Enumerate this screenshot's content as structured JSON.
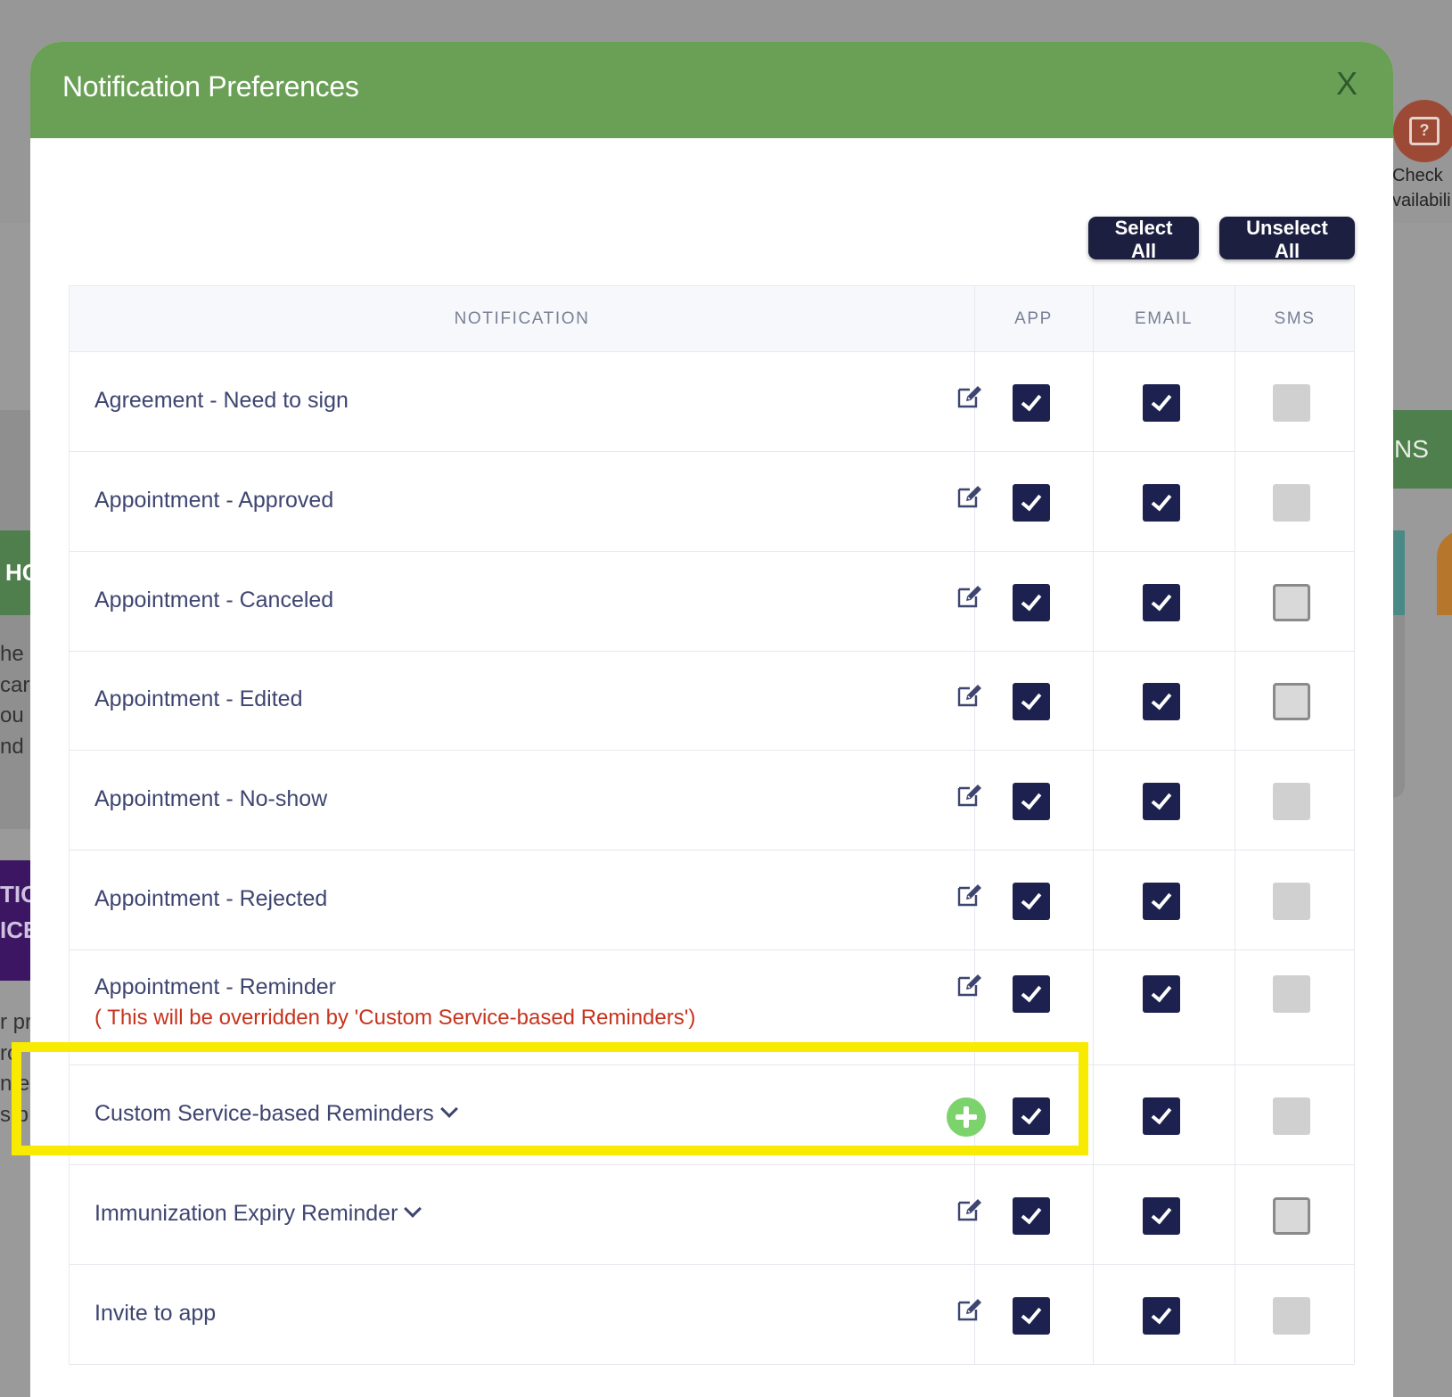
{
  "background": {
    "left_green_text": "HC",
    "left_text_lines": [
      "he",
      "car",
      "ou",
      "nd"
    ],
    "left_purple_lines": [
      "TIO",
      "ICE"
    ],
    "left_text_lines_2": [
      "r pr",
      "ro",
      "n e",
      "s p"
    ],
    "right_green_text": "NS",
    "calendar_label_1": "Check",
    "calendar_label_2": "vailabili",
    "calendar_icon": "calendar-question-icon"
  },
  "modal": {
    "title": "Notification Preferences",
    "close_label": "X",
    "select_all_label": "Select All",
    "unselect_all_label": "Unselect All"
  },
  "table": {
    "headers": {
      "notification": "NOTIFICATION",
      "app": "APP",
      "email": "EMAIL",
      "sms": "SMS"
    },
    "rows": [
      {
        "label": "Agreement - Need to sign",
        "action": "edit",
        "app": true,
        "email": true,
        "sms": "disabled"
      },
      {
        "label": "Appointment - Approved",
        "action": "edit",
        "app": true,
        "email": true,
        "sms": "disabled"
      },
      {
        "label": "Appointment - Canceled",
        "action": "edit",
        "app": true,
        "email": true,
        "sms": "unchecked"
      },
      {
        "label": "Appointment - Edited",
        "action": "edit",
        "app": true,
        "email": true,
        "sms": "unchecked"
      },
      {
        "label": "Appointment - No-show",
        "action": "edit",
        "app": true,
        "email": true,
        "sms": "disabled"
      },
      {
        "label": "Appointment - Rejected",
        "action": "edit",
        "app": true,
        "email": true,
        "sms": "disabled"
      },
      {
        "label": "Appointment - Reminder",
        "note": "( This will be overridden by 'Custom Service-based Reminders')",
        "action": "edit",
        "app": true,
        "email": true,
        "sms": "disabled"
      },
      {
        "label": "Custom Service-based Reminders",
        "expandable": true,
        "action": "add",
        "app": true,
        "email": true,
        "sms": "disabled",
        "highlighted": true
      },
      {
        "label": "Immunization Expiry Reminder",
        "expandable": true,
        "action": "edit",
        "app": true,
        "email": true,
        "sms": "unchecked"
      },
      {
        "label": "Invite to app",
        "action": "edit",
        "app": true,
        "email": true,
        "sms": "disabled"
      }
    ]
  },
  "colors": {
    "header_green": "#6aa055",
    "checkbox_navy": "#1c214f",
    "note_red": "#c8331d",
    "highlight_yellow": "#f8ea00",
    "add_green": "#7cd36c"
  }
}
